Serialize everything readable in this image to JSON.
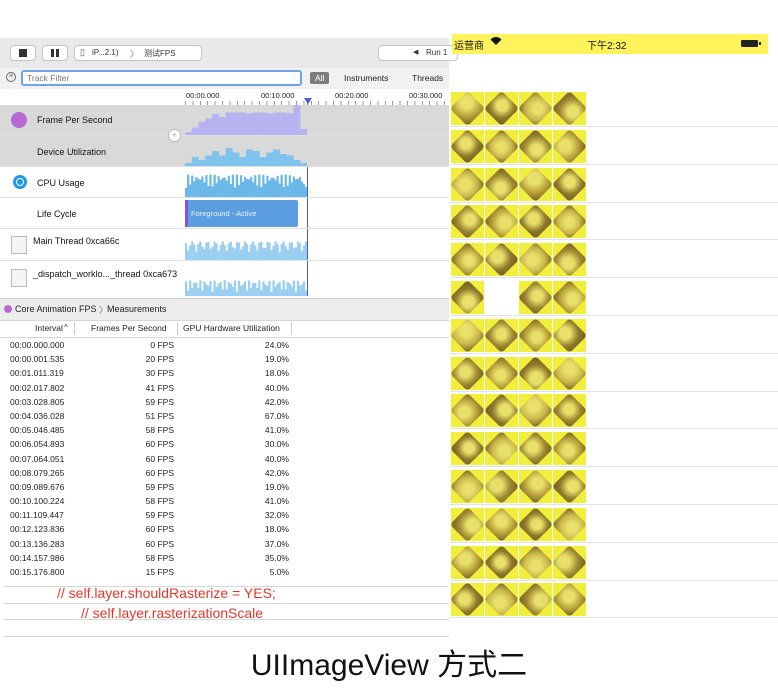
{
  "instruments": {
    "toolbar": {
      "device_label": "iP...2.1)",
      "target_label": "测试FPS",
      "run_label": "Run 1"
    },
    "filter": {
      "placeholder": "Track Filter",
      "tabs": [
        "All",
        "Instruments",
        "Threads"
      ]
    },
    "ruler_ticks": [
      "00:00.000",
      "00:10.000",
      "00:20.000",
      "00:30.000"
    ],
    "tracks": [
      {
        "label": "Frame Per Second",
        "icon": "core-animation-icon"
      },
      {
        "label": "Device Utilization"
      },
      {
        "label": "CPU Usage",
        "icon": "cpu-icon"
      },
      {
        "label": "Life Cycle",
        "bar_label": "Foreground - Active"
      },
      {
        "label": "Main Thread  0xca66c"
      },
      {
        "label": "_dispatch_worklo..._thread  0xca673"
      }
    ],
    "detail_breadcrumb": [
      "Core Animation FPS",
      "Measurements"
    ],
    "columns": [
      "Interval",
      "Frames Per Second",
      "GPU Hardware Utilization"
    ],
    "measurements": [
      [
        "00:00.000.000",
        "0 FPS",
        "24.0%"
      ],
      [
        "00:00.001.535",
        "20 FPS",
        "19.0%"
      ],
      [
        "00:01.011.319",
        "30 FPS",
        "18.0%"
      ],
      [
        "00:02.017.802",
        "41 FPS",
        "40.0%"
      ],
      [
        "00:03.028.805",
        "59 FPS",
        "42.0%"
      ],
      [
        "00:04.036.028",
        "51 FPS",
        "67.0%"
      ],
      [
        "00:05.046.485",
        "58 FPS",
        "41.0%"
      ],
      [
        "00:06.054.893",
        "60 FPS",
        "30.0%"
      ],
      [
        "00:07.064.051",
        "60 FPS",
        "40.0%"
      ],
      [
        "00:08.079.265",
        "60 FPS",
        "42.0%"
      ],
      [
        "00:09.089.676",
        "59 FPS",
        "19.0%"
      ],
      [
        "00:10.100.224",
        "58 FPS",
        "41.0%"
      ],
      [
        "00:11.109.447",
        "59 FPS",
        "32.0%"
      ],
      [
        "00:12.123.836",
        "60 FPS",
        "18.0%"
      ],
      [
        "00:13.136.283",
        "60 FPS",
        "37.0%"
      ],
      [
        "00:14.157.986",
        "58 FPS",
        "35.0%"
      ],
      [
        "00:15.176.800",
        "15 FPS",
        "5.0%"
      ]
    ]
  },
  "code_comments": [
    "//    self.layer.shouldRasterize = YES;",
    "//    self.layer.rasterizationScale"
  ],
  "caption": "UIImageView 方式二",
  "phone": {
    "carrier": "运营商",
    "time": "下午2:32",
    "highlight_color": "#fff25a",
    "image_rows": 14
  }
}
